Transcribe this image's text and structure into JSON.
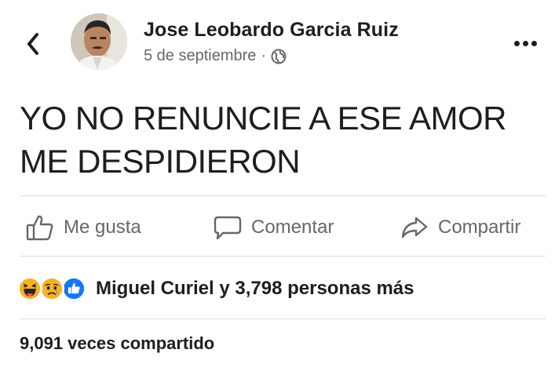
{
  "post": {
    "author": "Jose Leobardo Garcia Ruiz",
    "date": "5 de septiembre",
    "separator": "·",
    "privacy_icon": "globe-icon",
    "text_lines": [
      "YO NO RENUNCIE A ESE AMOR",
      "ME DESPIDIERON"
    ]
  },
  "actions": {
    "like": {
      "label": "Me gusta",
      "icon": "thumbs-up-icon"
    },
    "comment": {
      "label": "Comentar",
      "icon": "comment-icon"
    },
    "share": {
      "label": "Compartir",
      "icon": "share-icon"
    }
  },
  "reactions": {
    "icons": [
      "haha-emoji-icon",
      "sad-emoji-icon",
      "like-reaction-icon"
    ],
    "summary": "Miguel Curiel y 3,798 personas más"
  },
  "shares": {
    "label": "9,091 veces compartido"
  },
  "colors": {
    "text": "#1c1e21",
    "secondary": "#65676b",
    "like_blue": "#1877f2",
    "reaction_yellow": "#f7b125",
    "divider": "#dadde1"
  }
}
